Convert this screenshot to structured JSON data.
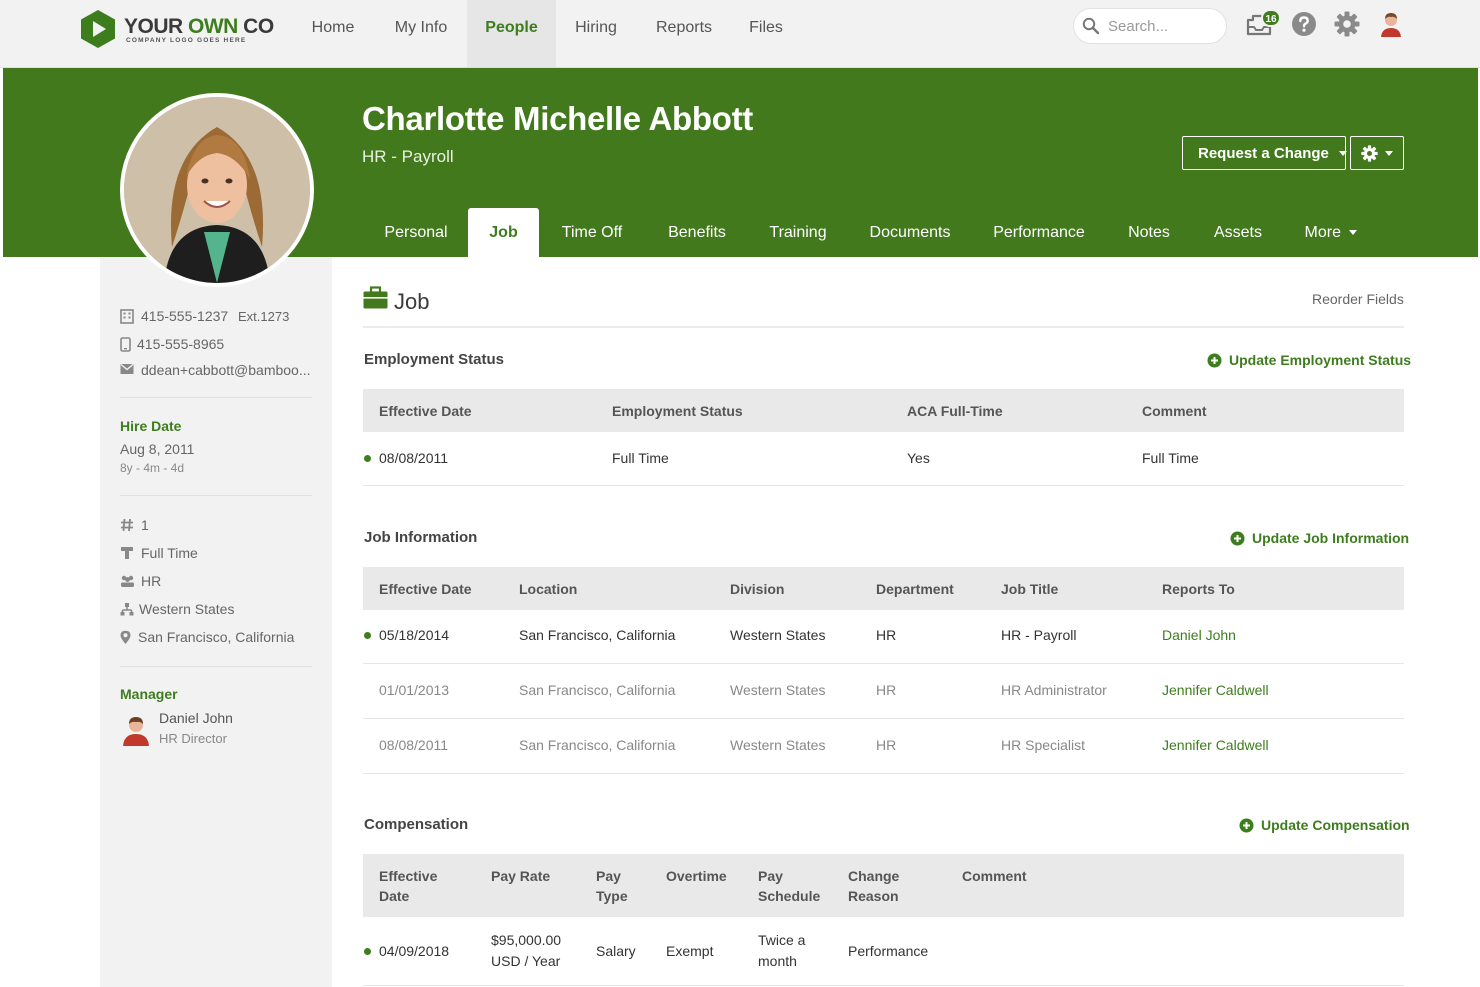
{
  "brand": {
    "name_part1": "YOUR ",
    "name_part2": "OWN",
    "name_part3": " CO",
    "tagline": "COMPANY LOGO GOES HERE"
  },
  "nav": {
    "items": [
      "Home",
      "My Info",
      "People",
      "Hiring",
      "Reports",
      "Files"
    ],
    "active": "People",
    "search_placeholder": "Search...",
    "notifications_count": "16"
  },
  "employee": {
    "name": "Charlotte Michelle Abbott",
    "title": "HR - Payroll",
    "request_change_label": "Request a Change"
  },
  "tabs": {
    "items": [
      "Personal",
      "Job",
      "Time Off",
      "Benefits",
      "Training",
      "Documents",
      "Performance",
      "Notes",
      "Assets",
      "More"
    ],
    "active": "Job"
  },
  "sidebar": {
    "work_phone": "415-555-1237",
    "work_ext": "Ext.1273",
    "mobile_phone": "415-555-8965",
    "email": "ddean+cabbott@bamboo...",
    "hire_date_label": "Hire Date",
    "hire_date": "Aug 8, 2011",
    "tenure": "8y - 4m - 4d",
    "employee_number": "1",
    "employment_type": "Full Time",
    "department": "HR",
    "division": "Western States",
    "location": "San Francisco, California",
    "manager_label": "Manager",
    "manager_name": "Daniel John",
    "manager_title": "HR Director"
  },
  "main": {
    "title": "Job",
    "reorder_label": "Reorder Fields"
  },
  "employment_status": {
    "heading": "Employment Status",
    "action": "Update Employment Status",
    "columns": [
      "Effective Date",
      "Employment Status",
      "ACA Full-Time",
      "Comment"
    ],
    "rows": [
      {
        "date": "08/08/2011",
        "status": "Full Time",
        "aca": "Yes",
        "comment": "Full Time"
      }
    ]
  },
  "job_information": {
    "heading": "Job Information",
    "action": "Update Job Information",
    "columns": [
      "Effective Date",
      "Location",
      "Division",
      "Department",
      "Job Title",
      "Reports To"
    ],
    "rows": [
      {
        "date": "05/18/2014",
        "location": "San Francisco, California",
        "division": "Western States",
        "department": "HR",
        "job_title": "HR - Payroll",
        "reports_to": "Daniel John"
      },
      {
        "date": "01/01/2013",
        "location": "San Francisco, California",
        "division": "Western States",
        "department": "HR",
        "job_title": "HR Administrator",
        "reports_to": "Jennifer Caldwell"
      },
      {
        "date": "08/08/2011",
        "location": "San Francisco, California",
        "division": "Western States",
        "department": "HR",
        "job_title": "HR Specialist",
        "reports_to": "Jennifer Caldwell"
      }
    ]
  },
  "compensation": {
    "heading": "Compensation",
    "action": "Update Compensation",
    "columns": {
      "effective_date_1": "Effective",
      "effective_date_2": "Date",
      "pay_rate": "Pay Rate",
      "pay_type_1": "Pay",
      "pay_type_2": "Type",
      "overtime": "Overtime",
      "pay_schedule_1": "Pay",
      "pay_schedule_2": "Schedule",
      "change_reason_1": "Change",
      "change_reason_2": "Reason",
      "comment": "Comment"
    },
    "rows": [
      {
        "date": "04/09/2018",
        "pay_rate_1": "$95,000.00",
        "pay_rate_2": "USD / Year",
        "pay_type": "Salary",
        "overtime": "Exempt",
        "pay_schedule_1": "Twice a",
        "pay_schedule_2": "month",
        "change_reason": "Performance",
        "comment": ""
      }
    ]
  },
  "colors": {
    "brand_green": "#43791d",
    "link_green": "#3e7d1e"
  }
}
